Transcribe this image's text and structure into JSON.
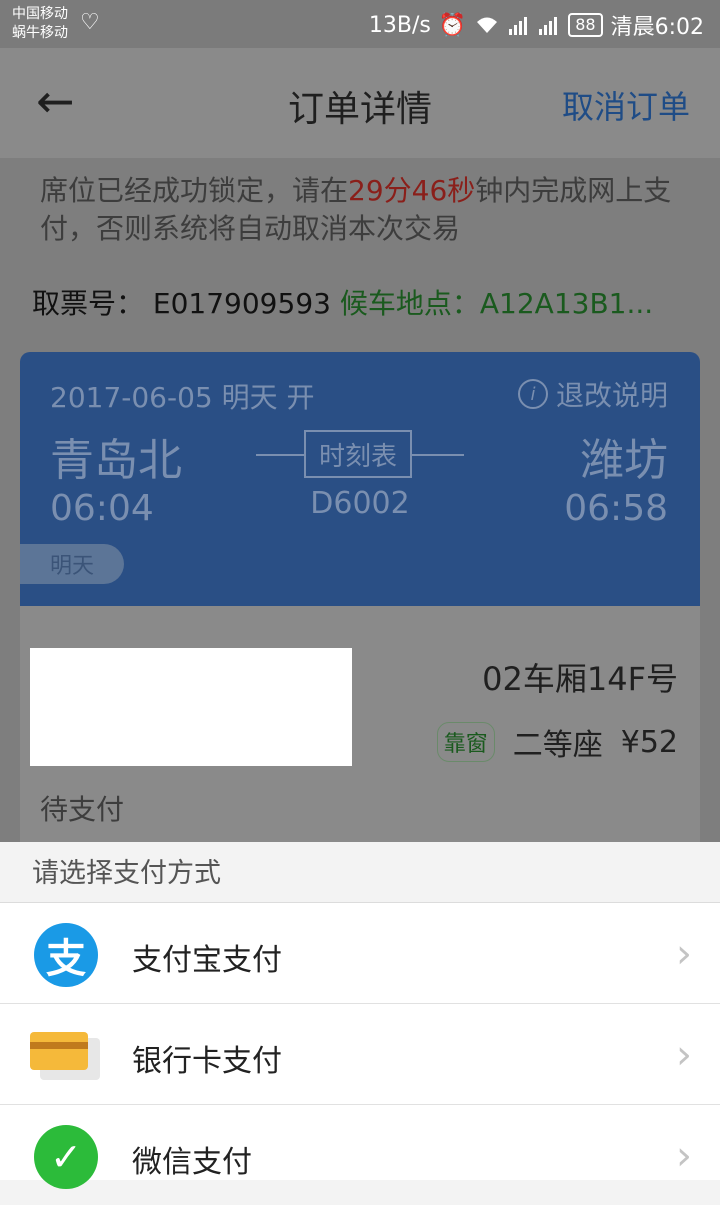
{
  "status_bar": {
    "carrier1": "中国移动",
    "carrier2": "蜗牛移动",
    "speed": "13B/s",
    "battery": "88",
    "time": "清晨6:02"
  },
  "header": {
    "title": "订单详情",
    "cancel_label": "取消订单"
  },
  "notice": {
    "prefix": "席位已经成功锁定，请在",
    "countdown": "29分46秒",
    "suffix": "钟内完成网上支付，否则系统将自动取消本次交易"
  },
  "ticket": {
    "number_label": "取票号：",
    "number": "E017909593",
    "location_label": "候车地点：",
    "location": "A12A13B1..."
  },
  "train": {
    "date": "2017-06-05 明天 开",
    "refund_label": "退改说明",
    "from_station": "青岛北",
    "to_station": "潍坊",
    "depart_time": "06:04",
    "arrive_time": "06:58",
    "timetable_label": "时刻表",
    "train_number": "D6002",
    "tomorrow_badge": "明天"
  },
  "seat": {
    "car": "02车厢14F号",
    "window_badge": "靠窗",
    "class": "二等座",
    "price": "¥52",
    "status": "待支付"
  },
  "payment": {
    "title": "请选择支付方式",
    "methods": [
      {
        "label": "支付宝支付",
        "icon": "alipay-icon"
      },
      {
        "label": "银行卡支付",
        "icon": "bank-card-icon"
      },
      {
        "label": "微信支付",
        "icon": "wechat-pay-icon"
      }
    ]
  },
  "colors": {
    "train_card": "#2a4f85",
    "countdown": "#8a1f1a",
    "alipay": "#1a9ae6",
    "wechat": "#2cbb3a"
  }
}
